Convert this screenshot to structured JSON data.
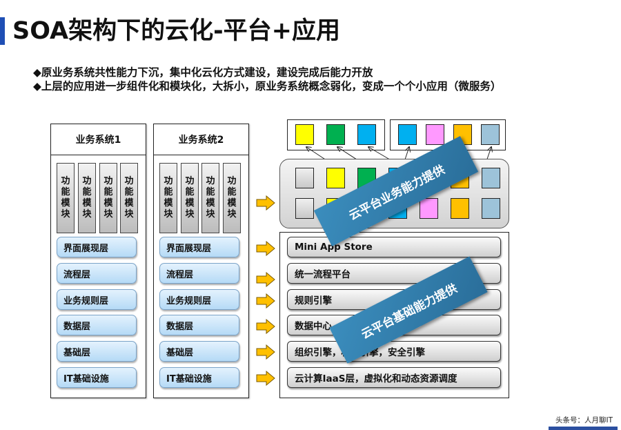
{
  "title": "SOA架构下的云化-平台+应用",
  "bullets": [
    "◆原业务系统共性能力下沉，集中化云化方式建设，建设完成后能力开放",
    "◆上层的应用进一步组件化和模块化，大拆小，原业务系统概念弱化，变成一个个小应用（微服务）"
  ],
  "systems": [
    {
      "name": "业务系统1",
      "module_label": "功能模块",
      "modules": [
        "功",
        "能",
        "模",
        "块"
      ],
      "layers": [
        "界面展现层",
        "流程层",
        "业务规则层",
        "数据层",
        "基础层",
        "IT基础设施"
      ]
    },
    {
      "name": "业务系统2",
      "module_label": "功能模块",
      "modules": [
        "功",
        "能",
        "模",
        "块"
      ],
      "layers": [
        "界面展现层",
        "流程层",
        "业务规则层",
        "数据层",
        "基础层",
        "IT基础设施"
      ]
    }
  ],
  "apps": {
    "group1": [
      "#ffff00",
      "#00b050",
      "#00b0f0"
    ],
    "group2": [
      "#00b0f0",
      "#ff99ff",
      "#ffc000",
      "#9dc3d9"
    ]
  },
  "capabilities": {
    "row1": [
      "#d9d9d9",
      "#ffff00",
      "#00b050",
      "#00b0f0",
      "#ff99ff",
      "#ffc000",
      "#9dc3d9"
    ],
    "row2": [
      "#d9d9d9",
      "#ffff00",
      "#00b050",
      "#00b0f0",
      "#ff99ff",
      "#ffc000",
      "#9dc3d9"
    ]
  },
  "platform_layers": [
    "Mini App Store",
    "统一流程平台",
    "规则引擎",
    "数据中心，大数据平台",
    "组织引擎，权限引擎，安全引擎",
    "云计算IaaS层，虚拟化和动态资源调度"
  ],
  "banners": {
    "business": "云平台业务能力提供",
    "base": "云平台基础能力提供"
  },
  "colors": {
    "title_accent": "#1f4fb5",
    "arrow": "#ffc000",
    "banner": "#3b8dbd"
  },
  "footer": "头条号：人月聊IT"
}
